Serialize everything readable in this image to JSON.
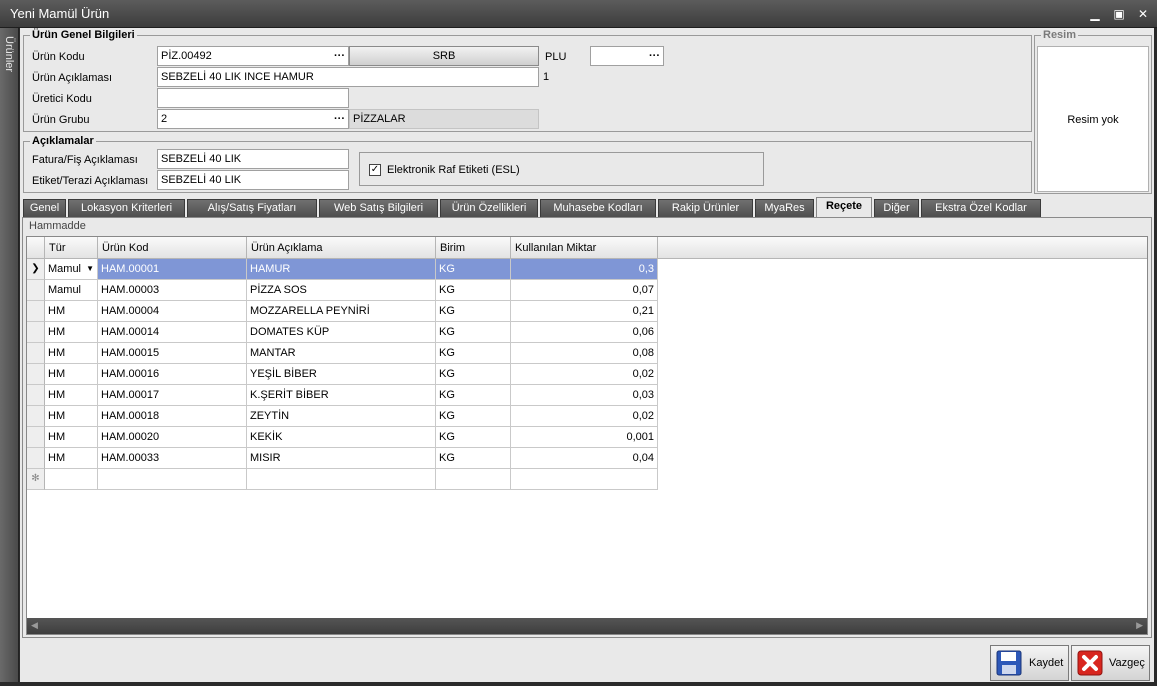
{
  "window": {
    "title": "Yeni Mamül Ürün",
    "side_tab": "Ürünler"
  },
  "general": {
    "group_title": "Ürün Genel Bilgileri",
    "urun_kodu_label": "Ürün Kodu",
    "urun_kodu_value": "PİZ.00492",
    "srb_label": "SRB",
    "plu_label": "PLU",
    "plu_value": "",
    "aciklama_label": "Ürün Açıklaması",
    "aciklama_value": "SEBZELİ 40 LIK INCE HAMUR",
    "aciklama_counter": "1",
    "uretici_label": "Üretici Kodu",
    "uretici_value": "",
    "grup_label": "Ürün Grubu",
    "grup_value": "2",
    "grup_name": "PİZZALAR",
    "lookup_dots": "···"
  },
  "aciklamalar": {
    "group_title": "Açıklamalar",
    "fatura_label": "Fatura/Fiş Açıklaması",
    "fatura_value": "SEBZELİ 40 LIK",
    "etiket_label": "Etiket/Terazi Açıklaması",
    "etiket_value": "SEBZELİ 40 LIK",
    "esl_label": "Elektronik Raf Etiketi (ESL)",
    "esl_checked": true,
    "check_mark": "✓"
  },
  "resim": {
    "group_title": "Resim",
    "placeholder": "Resim yok"
  },
  "tabs": [
    "Genel",
    "Lokasyon Kriterleri",
    "Alış/Satış Fiyatları",
    "Web Satış Bilgileri",
    "Ürün Özellikleri",
    "Muhasebe Kodları",
    "Rakip Ürünler",
    "MyaRes",
    "Reçete",
    "Diğer",
    "Ekstra Özel Kodlar"
  ],
  "active_tab": "Reçete",
  "panel_title": "Hammadde",
  "columns": [
    "Tür",
    "Ürün Kod",
    "Ürün Açıklama",
    "Birim",
    "Kullanılan Miktar"
  ],
  "rows": [
    {
      "tur": "Mamul",
      "kod": "HAM.00001",
      "aciklama": "HAMUR",
      "birim": "KG",
      "miktar": "0,3"
    },
    {
      "tur": "Mamul",
      "kod": "HAM.00003",
      "aciklama": "PİZZA SOS",
      "birim": "KG",
      "miktar": "0,07"
    },
    {
      "tur": "HM",
      "kod": "HAM.00004",
      "aciklama": "MOZZARELLA PEYNİRİ",
      "birim": "KG",
      "miktar": "0,21"
    },
    {
      "tur": "HM",
      "kod": "HAM.00014",
      "aciklama": "DOMATES KÜP",
      "birim": "KG",
      "miktar": "0,06"
    },
    {
      "tur": "HM",
      "kod": "HAM.00015",
      "aciklama": "MANTAR",
      "birim": "KG",
      "miktar": "0,08"
    },
    {
      "tur": "HM",
      "kod": "HAM.00016",
      "aciklama": "YEŞİL BİBER",
      "birim": "KG",
      "miktar": "0,02"
    },
    {
      "tur": "HM",
      "kod": "HAM.00017",
      "aciklama": "K.ŞERİT BİBER",
      "birim": "KG",
      "miktar": "0,03"
    },
    {
      "tur": "HM",
      "kod": "HAM.00018",
      "aciklama": "ZEYTİN",
      "birim": "KG",
      "miktar": "0,02"
    },
    {
      "tur": "HM",
      "kod": "HAM.00020",
      "aciklama": "KEKİK",
      "birim": "KG",
      "miktar": "0,001"
    },
    {
      "tur": "HM",
      "kod": "HAM.00033",
      "aciklama": "MISIR",
      "birim": "KG",
      "miktar": "0,04"
    }
  ],
  "selected_row": 0,
  "buttons": {
    "save": "Kaydet",
    "cancel": "Vazgeç"
  },
  "colors": {
    "selection": "#7f96d6",
    "cancel_icon": "#d8261f",
    "save_icon": "#2d58b8"
  }
}
